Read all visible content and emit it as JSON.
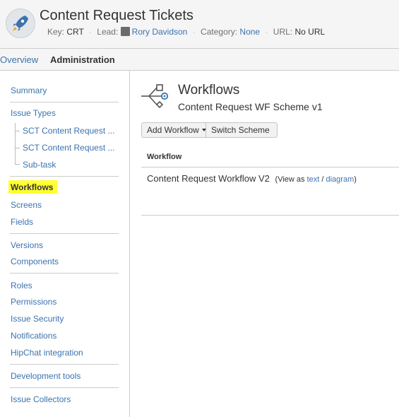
{
  "project": {
    "title": "Content Request Tickets",
    "key_label": "Key:",
    "key_value": "CRT",
    "lead_label": "Lead:",
    "lead_value": "Rory Davidson",
    "category_label": "Category:",
    "category_value": "None",
    "url_label": "URL:",
    "url_value": "No URL"
  },
  "tabs": {
    "overview": "Overview",
    "administration": "Administration"
  },
  "sidebar": {
    "summary": "Summary",
    "issue_types": "Issue Types",
    "issue_type_1": "SCT Content Request ...",
    "issue_type_2": "SCT Content Request ...",
    "issue_type_3": "Sub-task",
    "workflows": "Workflows",
    "screens": "Screens",
    "fields": "Fields",
    "versions": "Versions",
    "components": "Components",
    "roles": "Roles",
    "permissions": "Permissions",
    "issue_security": "Issue Security",
    "notifications": "Notifications",
    "hipchat": "HipChat integration",
    "dev_tools": "Development tools",
    "issue_collectors": "Issue Collectors"
  },
  "main": {
    "title": "Workflows",
    "scheme_name": "Content Request WF Scheme v1",
    "add_workflow": "Add Workflow",
    "switch_scheme": "Switch Scheme",
    "table_header": "Workflow",
    "workflow_name": "Content Request Workflow V2",
    "view_as_prefix": "(View as",
    "view_text": "text",
    "view_sep": "/",
    "view_diagram": "diagram",
    "view_suffix": ")"
  },
  "icons": {
    "project_avatar": "rocket-icon",
    "lead_avatar": "user-avatar-icon",
    "workflows_header": "workflow-icon",
    "dropdown": "caret-down-icon"
  },
  "colors": {
    "link": "#3b73af",
    "highlight": "#ffff33",
    "header_bg": "#f5f5f5",
    "border": "#cccccc"
  }
}
